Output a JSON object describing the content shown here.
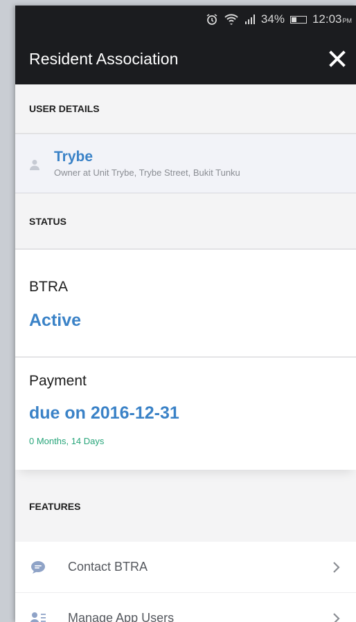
{
  "status_bar": {
    "battery": "34%",
    "time": "12:03",
    "ampm": "PM",
    "battery_level": 0.34
  },
  "header": {
    "title": "Resident Association"
  },
  "user_details": {
    "section_title": "USER DETAILS",
    "name": "Trybe",
    "description": "Owner at Unit Trybe, Trybe Street, Bukit Tunku"
  },
  "status": {
    "section_title": "STATUS",
    "association_label": "BTRA",
    "association_status": "Active",
    "payment_label": "Payment",
    "payment_due": "due on 2016-12-31",
    "payment_remaining": "0 Months, 14 Days"
  },
  "features": {
    "section_title": "FEATURES",
    "items": [
      {
        "label": "Contact BTRA",
        "icon": "chat-bubble-icon"
      },
      {
        "label": "Manage App Users",
        "icon": "users-list-icon"
      }
    ]
  },
  "colors": {
    "accent": "#3a82c7",
    "success": "#27a57a",
    "header_bg": "#1b1c1f"
  }
}
